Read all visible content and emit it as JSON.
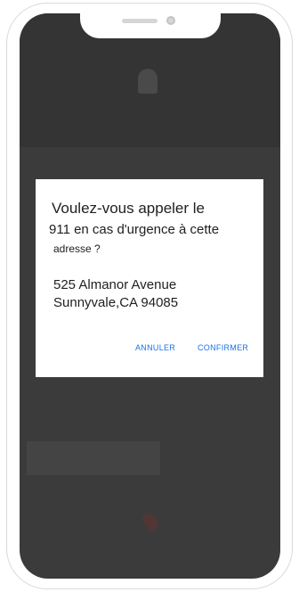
{
  "dialog": {
    "title_line1": "Voulez-vous appeler le",
    "title_line2": "911 en cas d'urgence à cette",
    "title_line3": "adresse ?",
    "address_line1": "525 Almanor Avenue",
    "address_line2": "Sunnyvale,CA 94085",
    "cancel_label": "ANNULER",
    "confirm_label": "CONFIRMER"
  },
  "colors": {
    "accent": "#1a73e8",
    "scrim": "#3b3b3b",
    "dialog_bg": "#ffffff"
  }
}
